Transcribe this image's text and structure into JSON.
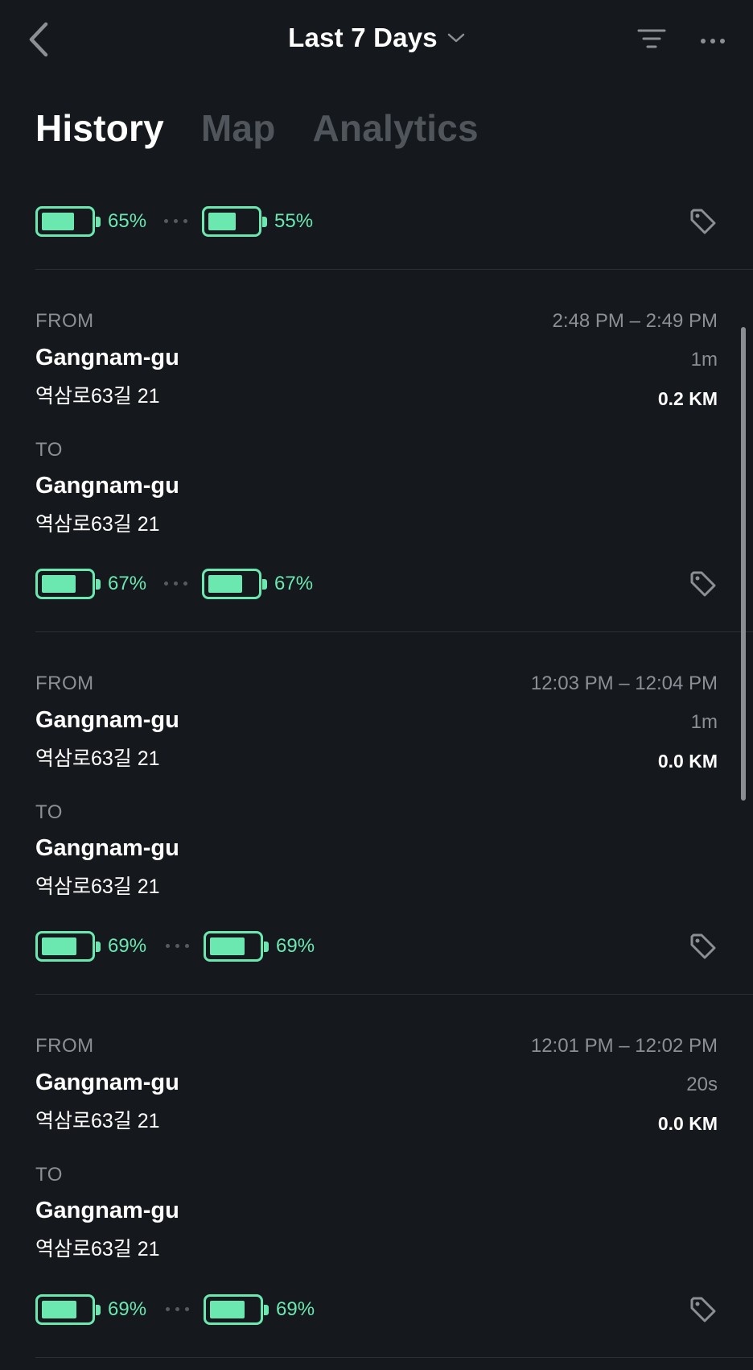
{
  "header": {
    "title": "Last 7 Days",
    "icons": [
      "chevron-left-icon",
      "chevron-down-icon",
      "filter-icon",
      "more-horizontal-icon"
    ]
  },
  "tabs": [
    {
      "label": "History",
      "active": true
    },
    {
      "label": "Map",
      "active": false
    },
    {
      "label": "Analytics",
      "active": false
    }
  ],
  "colors": {
    "background": "#15181d",
    "accent": "#6be8b0",
    "muted": "#8c9096",
    "inactive_tab": "#50555c",
    "divider": "#2c3036"
  },
  "top_battery": {
    "start_pct": "65%",
    "start_level": 0.65,
    "end_pct": "55%",
    "end_level": 0.55
  },
  "trips": [
    {
      "from_label": "FROM",
      "from_place": "Gangnam-gu",
      "from_address": "역삼로63길 21",
      "to_label": "TO",
      "to_place": "Gangnam-gu",
      "to_address": "역삼로63길 21",
      "time_range": "2:48 PM – 2:49 PM",
      "duration": "1m",
      "distance": "0.2 KM",
      "battery_start": "67%",
      "battery_start_level": 0.67,
      "battery_end": "67%",
      "battery_end_level": 0.67
    },
    {
      "from_label": "FROM",
      "from_place": "Gangnam-gu",
      "from_address": "역삼로63길 21",
      "to_label": "TO",
      "to_place": "Gangnam-gu",
      "to_address": "역삼로63길 21",
      "time_range": "12:03 PM – 12:04 PM",
      "duration": "1m",
      "distance": "0.0 KM",
      "battery_start": "69%",
      "battery_start_level": 0.69,
      "battery_end": "69%",
      "battery_end_level": 0.69
    },
    {
      "from_label": "FROM",
      "from_place": "Gangnam-gu",
      "from_address": "역삼로63길 21",
      "to_label": "TO",
      "to_place": "Gangnam-gu",
      "to_address": "역삼로63길 21",
      "time_range": "12:01 PM – 12:02 PM",
      "duration": "20s",
      "distance": "0.0 KM",
      "battery_start": "69%",
      "battery_start_level": 0.69,
      "battery_end": "69%",
      "battery_end_level": 0.69
    }
  ]
}
